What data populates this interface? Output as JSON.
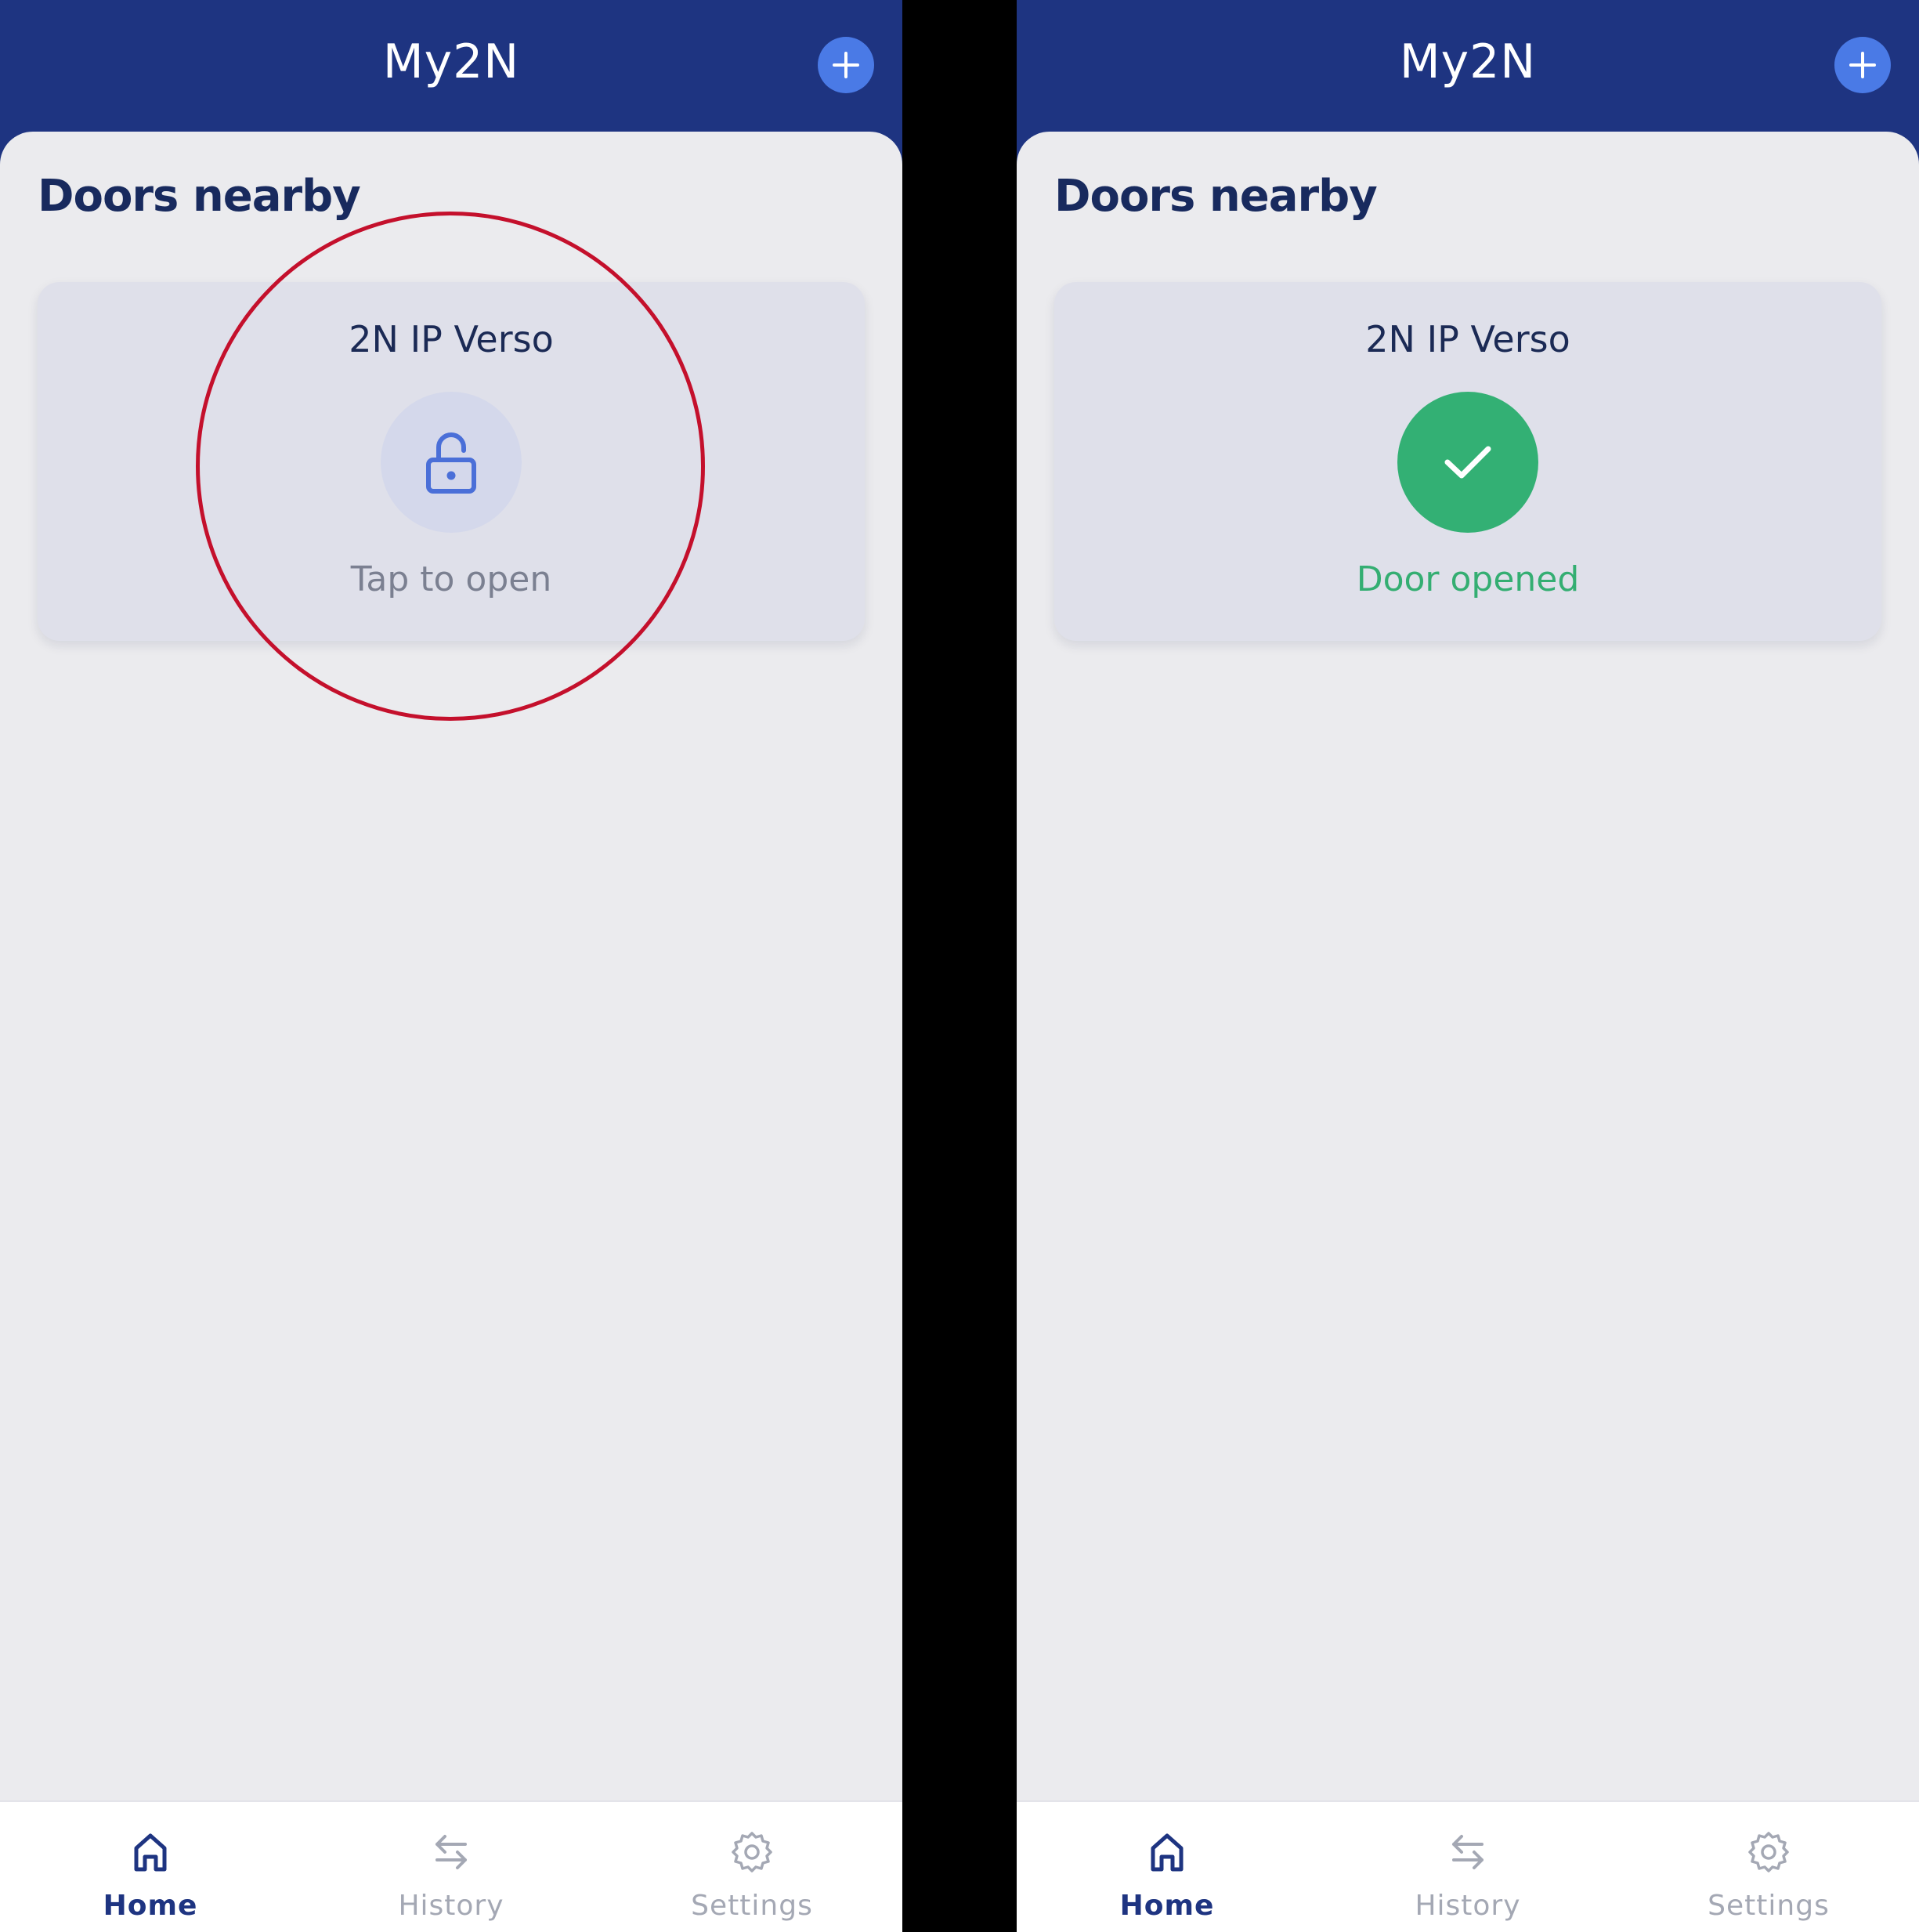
{
  "colors": {
    "header_bg": "#1e3481",
    "add_button": "#4a7ae6",
    "success": "#34ae72",
    "highlight_ring": "#c4102c",
    "nav_active": "#1e3481",
    "nav_inactive": "#a4a8b4"
  },
  "screens": [
    {
      "header": {
        "title": "My2N",
        "add_icon": "plus-icon"
      },
      "section_title": "Doors nearby",
      "door": {
        "name": "2N IP Verso",
        "status": "Tap to open",
        "icon": "unlock-icon"
      },
      "nav": [
        {
          "label": "Home",
          "icon": "home-icon",
          "active": true
        },
        {
          "label": "History",
          "icon": "swap-arrows-icon",
          "active": false
        },
        {
          "label": "Settings",
          "icon": "gear-icon",
          "active": false
        }
      ]
    },
    {
      "header": {
        "title": "My2N",
        "add_icon": "plus-icon"
      },
      "section_title": "Doors nearby",
      "door": {
        "name": "2N IP Verso",
        "status": "Door opened",
        "icon": "checkmark-icon"
      },
      "nav": [
        {
          "label": "Home",
          "icon": "home-icon",
          "active": true
        },
        {
          "label": "History",
          "icon": "swap-arrows-icon",
          "active": false
        },
        {
          "label": "Settings",
          "icon": "gear-icon",
          "active": false
        }
      ]
    }
  ]
}
